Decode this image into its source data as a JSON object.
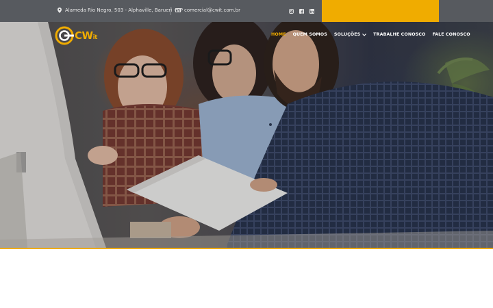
{
  "topbar": {
    "address": "Alameda Rio Negro, 503 - Alphaville, Barueri - SP",
    "email": "comercial@cwit.com.br",
    "address_icon": "map-marker-icon",
    "email_icon": "envelope-icon",
    "socials": [
      "instagram-icon",
      "facebook-icon",
      "linkedin-icon"
    ]
  },
  "logo": {
    "text": "CW",
    "suffix": "it"
  },
  "nav": {
    "items": [
      {
        "label": "HOME",
        "active": true
      },
      {
        "label": "QUEM SOMOS"
      },
      {
        "label": "SOLUÇÕES",
        "has_dropdown": true
      },
      {
        "label": "TRABALHE CONOSCO"
      },
      {
        "label": "FALE CONOSCO"
      }
    ]
  },
  "colors": {
    "accent": "#f0ac00",
    "topbar": "#575a5f"
  }
}
